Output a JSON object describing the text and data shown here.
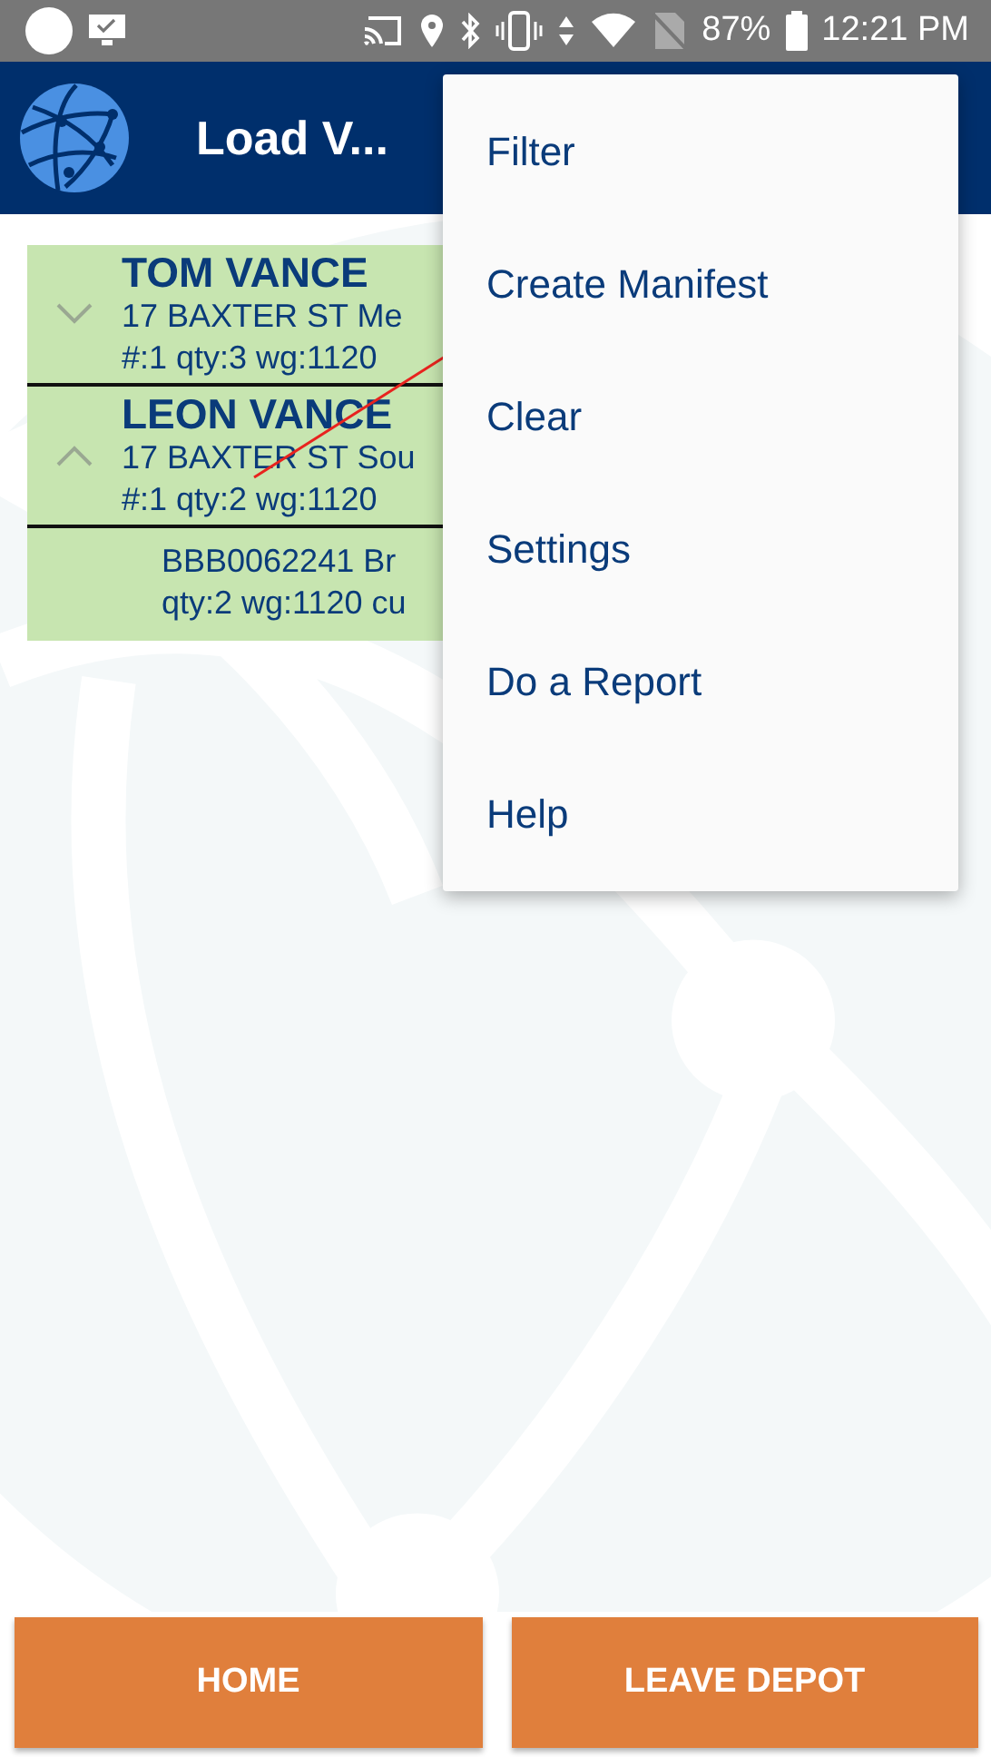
{
  "status_bar": {
    "battery": "87%",
    "time": "12:21 PM"
  },
  "app_bar": {
    "title": "Load V..."
  },
  "consignees": [
    {
      "name": "TOM VANCE",
      "address": "17 BAXTER ST Me",
      "summary": "#:1 qty:3 wg:1120",
      "expanded": false
    },
    {
      "name": "LEON VANCE",
      "address": "17 BAXTER ST Sou",
      "summary": "#:1 qty:2 wg:1120",
      "expanded": true,
      "children": [
        {
          "line1": "BBB0062241 Br",
          "line2": "qty:2 wg:1120 cu"
        }
      ]
    }
  ],
  "menu": {
    "items": [
      "Filter",
      "Create Manifest",
      "Clear",
      "Settings",
      "Do a Report",
      "Help"
    ]
  },
  "buttons": [
    "HOME",
    "LEAVE DEPOT"
  ]
}
